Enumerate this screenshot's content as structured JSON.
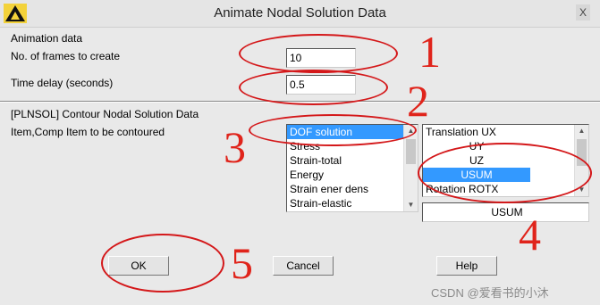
{
  "window": {
    "title": "Animate Nodal Solution Data",
    "close_glyph": "X"
  },
  "animation": {
    "section_label": "Animation data",
    "frames_label": "No. of frames to create",
    "frames_value": "10",
    "delay_label": "Time delay (seconds)",
    "delay_value": "0.5"
  },
  "contour": {
    "header_label": "[PLNSOL]  Contour Nodal Solution Data",
    "item_label": "Item,Comp   Item to be contoured",
    "item_list": [
      {
        "label": "DOF solution",
        "selected": true
      },
      {
        "label": "Stress",
        "selected": false
      },
      {
        "label": "Strain-total",
        "selected": false
      },
      {
        "label": "Energy",
        "selected": false
      },
      {
        "label": "Strain ener dens",
        "selected": false
      },
      {
        "label": "Strain-elastic",
        "selected": false
      }
    ],
    "comp_list": [
      {
        "label": "Translation   UX",
        "selected": false
      },
      {
        "label": "UY",
        "selected": false
      },
      {
        "label": "UZ",
        "selected": false
      },
      {
        "label": "USUM",
        "selected": true
      },
      {
        "label": "Rotation    ROTX",
        "selected": false
      }
    ],
    "comp_value": "USUM"
  },
  "buttons": {
    "ok": "OK",
    "cancel": "Cancel",
    "help": "Help"
  },
  "annotations": {
    "n1": "1",
    "n2": "2",
    "n3": "3",
    "n4": "4",
    "n5": "5",
    "color": "#e0241b"
  },
  "watermark": "CSDN @爱看书的小沐",
  "colors": {
    "selection": "#3399ff",
    "annotation": "#d4181a"
  }
}
